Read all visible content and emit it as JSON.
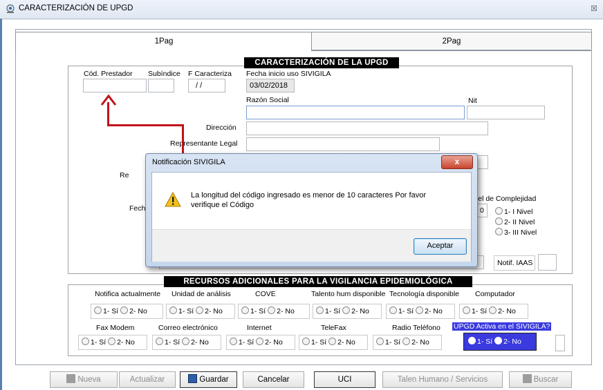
{
  "window": {
    "title": "CARACTERIZACIÓN DE UPGD"
  },
  "tabs": [
    {
      "label": "1Pag"
    },
    {
      "label": "2Pag"
    }
  ],
  "section1": {
    "heading": "CARACTERIZACIÓN DE LA UPGD",
    "cod_prestador": "Cód. Prestador",
    "subindice": "Subíndice",
    "f_caracteriza": "F Caracteriza",
    "f_caracteriza_value": "/ /",
    "fecha_inicio_label": "Fecha inicio uso SIVIGILA",
    "fecha_inicio_value": "03/02/2018",
    "razon_social": "Razón Social",
    "nit": "Nit",
    "direccion": "Dirección",
    "representante": "Representante Legal",
    "re_partial": "Re",
    "fech_partial": "Fech",
    "nivel_label": "vel de Complejidad",
    "nivel_value": "0",
    "nivel_options": [
      "1- I  Nivel",
      "2- II Nivel",
      "3- III Nivel"
    ],
    "notif_iaas": "Notif. IAAS"
  },
  "dialog": {
    "title": "Notificación SIVIGILA",
    "message_line1": "La longitud del código ingresado es menor de 10 caracteres Por favor",
    "message_line2": "verifique el Código",
    "ok": "Aceptar",
    "close": "x"
  },
  "section2": {
    "heading": "RECURSOS ADICIONALES PARA LA VIGILANCIA EPIDEMIOLÓGICA",
    "row1": [
      "Notifica actualmente",
      "Unidad de análisis",
      "COVE",
      "Talento hum disponible",
      "Tecnología disponible",
      "Computador"
    ],
    "row2": [
      "Fax Modem",
      "Correo electrónico",
      "Internet",
      "TeleFax",
      "Radio Teléfono",
      "UPGD Activa en el SIVIGILA?"
    ],
    "opt_si": "1- Sí",
    "opt_no": "2- No"
  },
  "buttons": {
    "nueva": "Nueva",
    "actualizar": "Actualizar",
    "guardar": "Guardar",
    "cancelar": "Cancelar",
    "uci": "UCI",
    "talento": "Talen Humano / Servicios",
    "buscar": "Buscar"
  },
  "colors": {
    "arrow": "#c1121a",
    "active_highlight": "#3a3adf"
  }
}
